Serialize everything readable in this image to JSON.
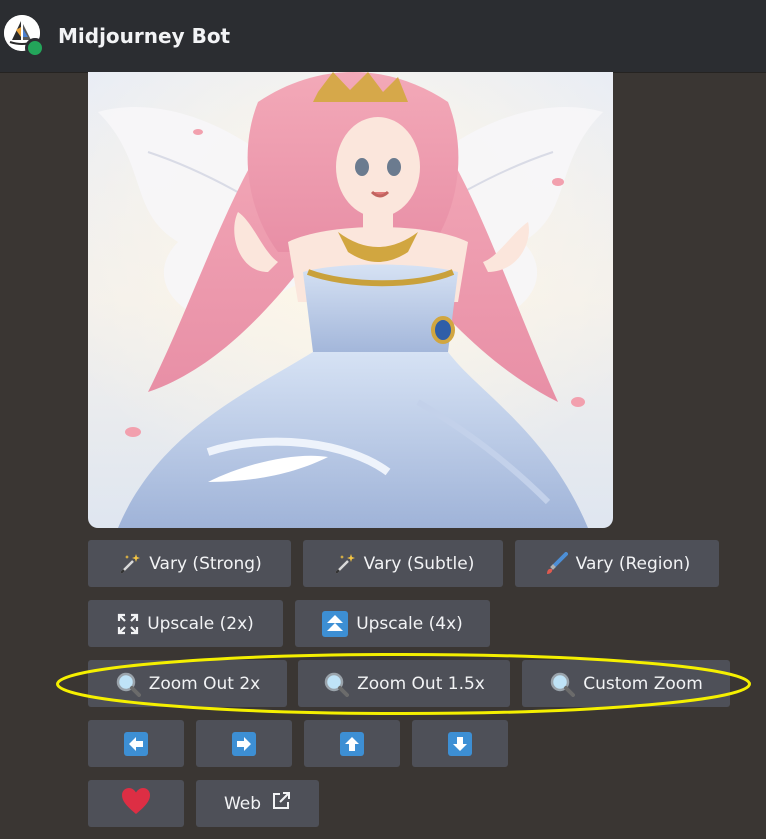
{
  "header": {
    "bot_name": "Midjourney Bot"
  },
  "image": {
    "alt": ""
  },
  "buttons": {
    "vary_strong": "Vary (Strong)",
    "vary_subtle": "Vary (Subtle)",
    "vary_region": "Vary (Region)",
    "upscale_2x": "Upscale (2x)",
    "upscale_4x": "Upscale (4x)",
    "zoom_out_2x": "Zoom Out 2x",
    "zoom_out_1_5x": "Zoom Out 1.5x",
    "custom_zoom": "Custom Zoom",
    "web": "Web"
  },
  "icons": {
    "wand": "magic-wand-icon",
    "brush": "paintbrush-icon",
    "expand": "expand-icon",
    "upscale": "double-up-arrow-icon",
    "zoom": "magnifier-icon",
    "left": "arrow-left-icon",
    "right": "arrow-right-icon",
    "up": "arrow-up-icon",
    "down": "arrow-down-icon",
    "heart": "heart-icon",
    "external": "external-link-icon"
  },
  "colors": {
    "background": "#3a3633",
    "header": "#2b2d31",
    "button": "#4e5058",
    "arrow_button": "#3d8fd4",
    "heart": "#dd2e44",
    "highlight": "#f5f000",
    "online": "#23a55a"
  }
}
